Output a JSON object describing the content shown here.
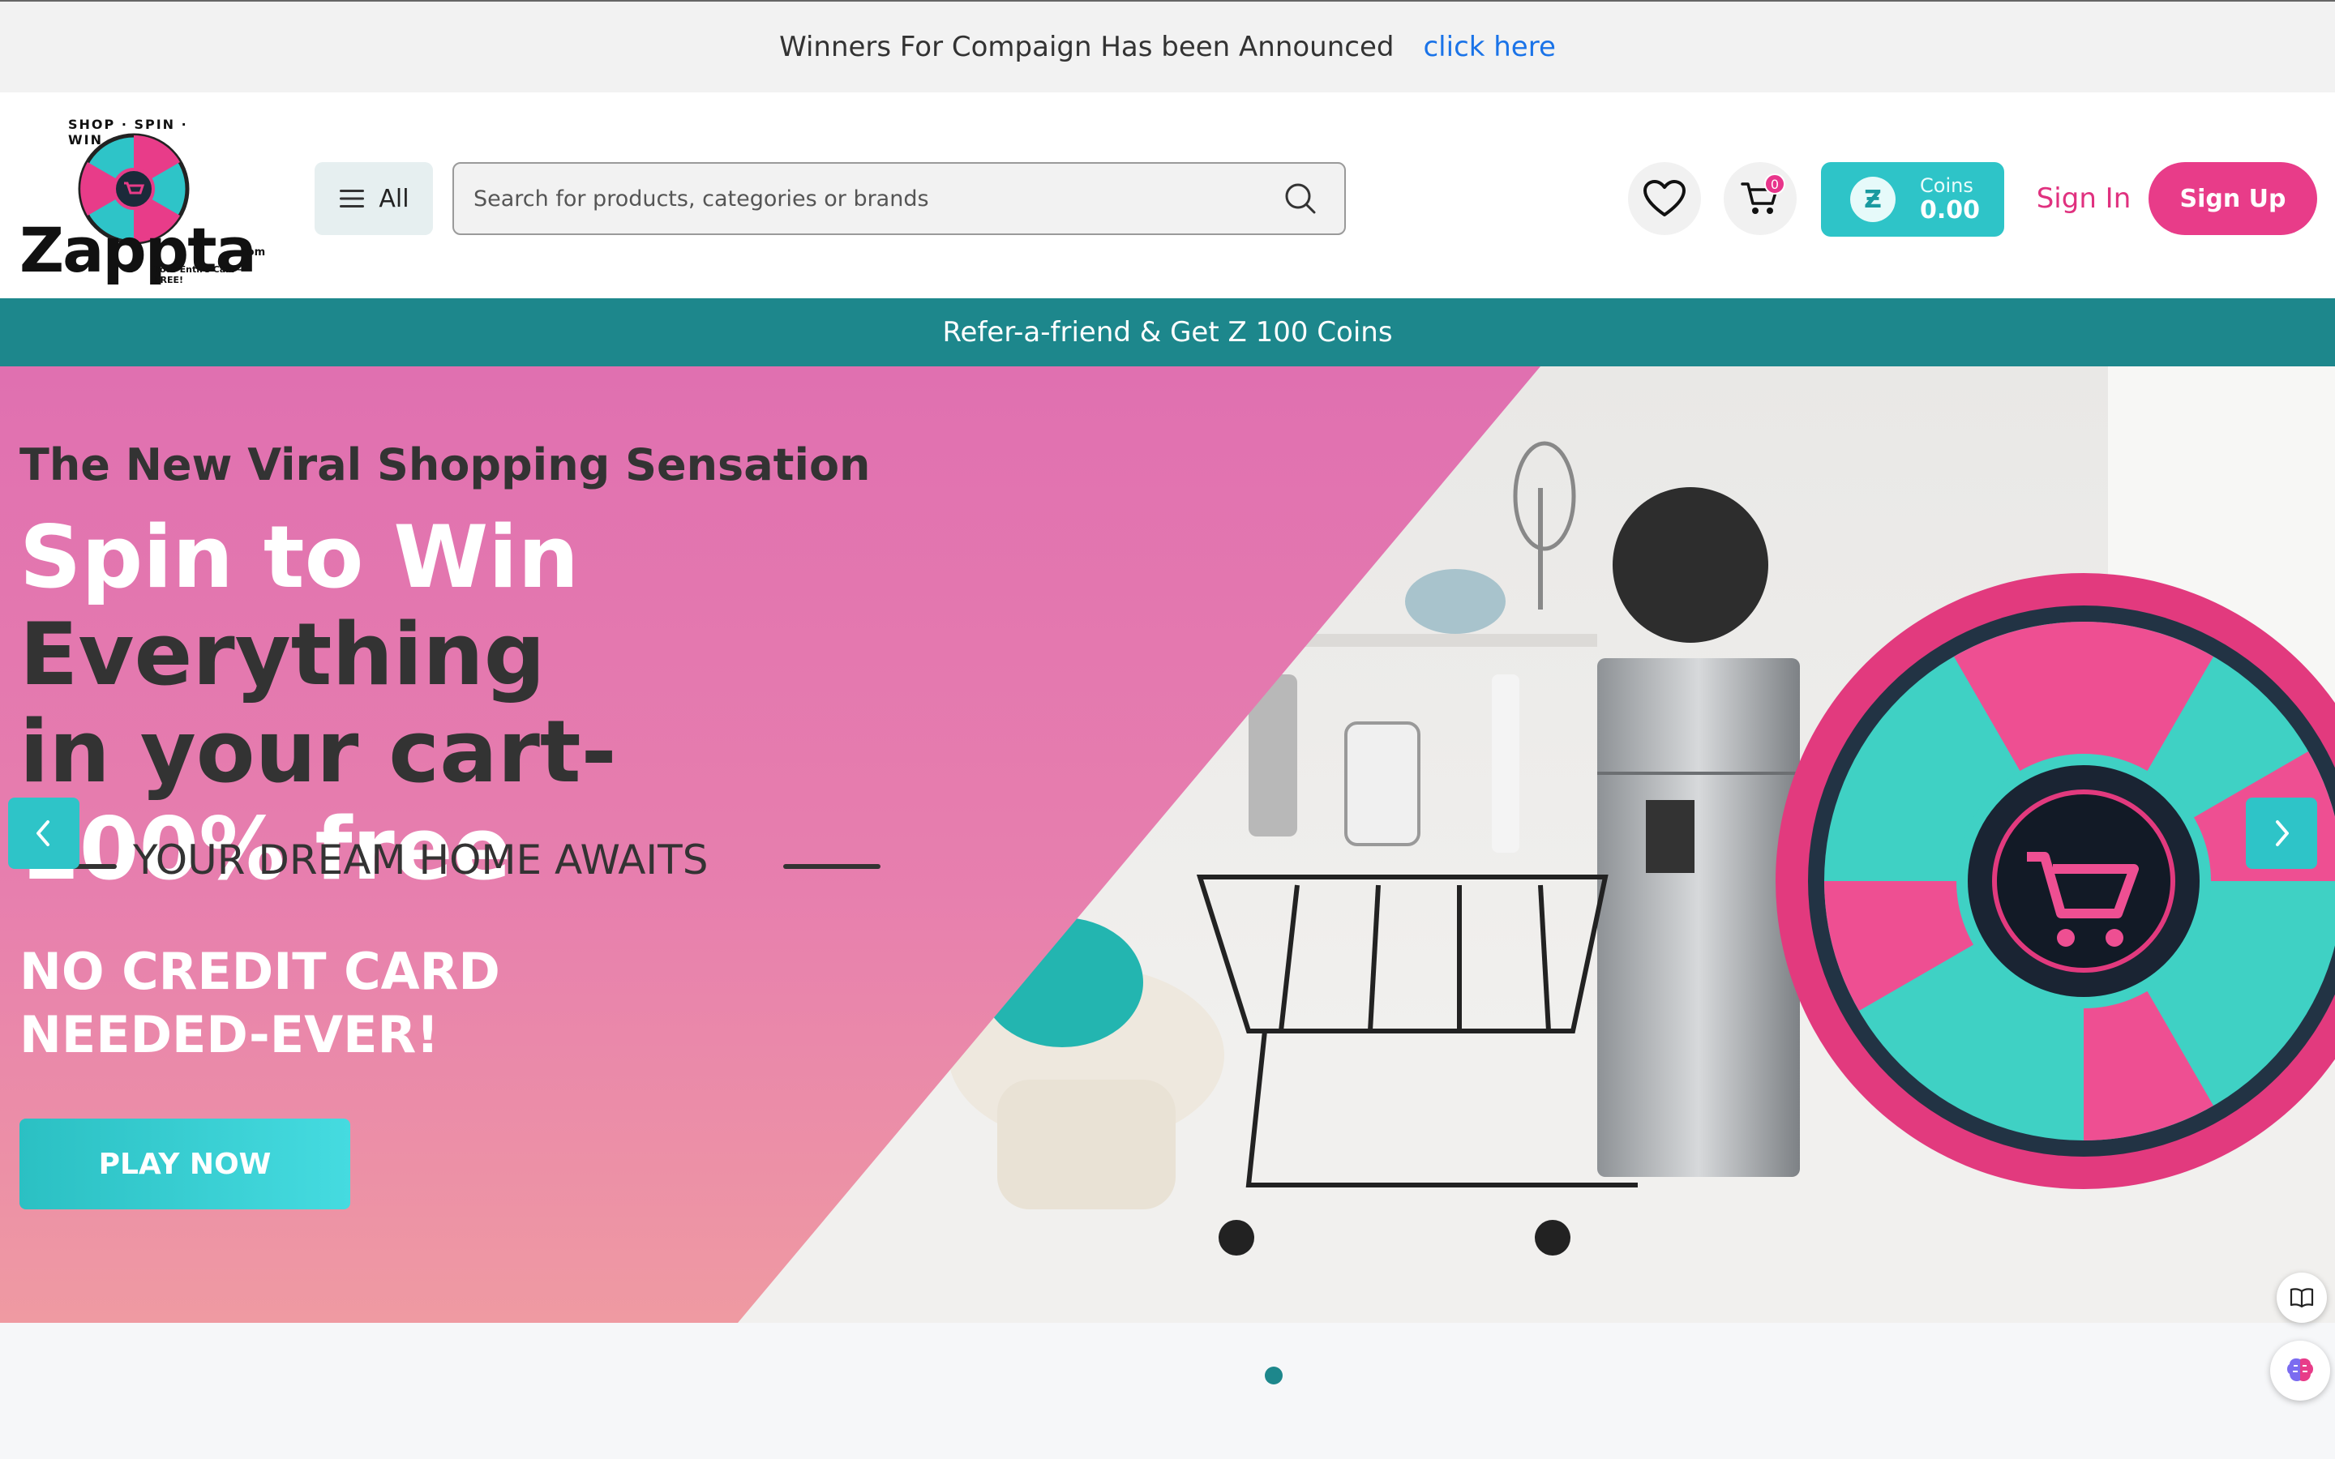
{
  "announcement": {
    "message": "Winners For Compaign Has been Announced",
    "link": "click here"
  },
  "header": {
    "logo": {
      "name": "Zappta",
      "suffix": ".com",
      "arc": "SHOP · SPIN · WIN",
      "tagline": "Your Entire Cart — FREE!"
    },
    "all_label": "All",
    "search_placeholder": "Search for products, categories or brands",
    "cart_count": "0",
    "coins_label": "Coins",
    "coins_value": "0.00",
    "signin": "Sign In",
    "signup": "Sign Up"
  },
  "refer_bar": "Refer-a-friend & Get Z 100 Coins",
  "hero": {
    "subtitle": "The New Viral Shopping Sensation",
    "headline_part1": "Spin to Win ",
    "headline_part2": "Everything",
    "headline_part3": "in your cart-",
    "headline_part4": "100% free",
    "dream": "YOUR DREAM HOME AWAITS",
    "nocc_line1": "NO CREDIT CARD",
    "nocc_line2": "NEEDED-EVER!",
    "cta": "PLAY NOW"
  },
  "colors": {
    "teal": "#1d878c",
    "aqua": "#2ec4c8",
    "pink": "#e83c89"
  },
  "icons": [
    "menu-icon",
    "search-icon",
    "heart-icon",
    "cart-icon",
    "coin-icon",
    "chevron-left-icon",
    "chevron-right-icon",
    "book-icon",
    "brain-icon"
  ]
}
